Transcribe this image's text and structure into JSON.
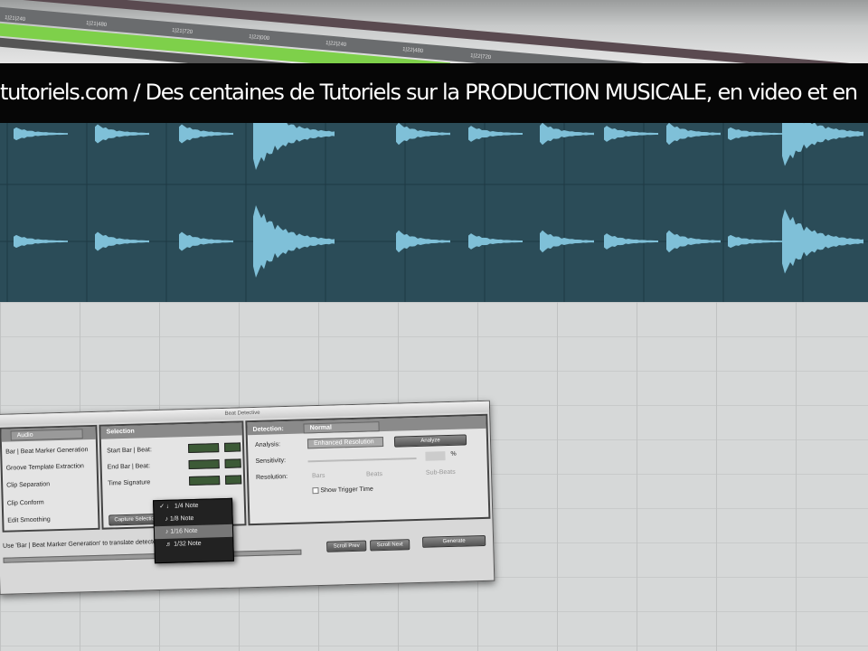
{
  "ruler": {
    "ticks": [
      "1|21|240",
      "1|21|480",
      "1|21|720",
      "1|22|000",
      "1|22|240",
      "1|22|480",
      "1|22|720"
    ]
  },
  "banner": {
    "text": "tutoriels.com / Des centaines de Tutoriels sur la PRODUCTION MUSICALE, en video et en"
  },
  "colors": {
    "waveform_bg": "#2b4c58",
    "waveform": "#7fc0d8",
    "ruler_green": "#7ed04a"
  },
  "dialog": {
    "title": "Beat Detective",
    "mode": "Audio",
    "operations": [
      "Bar | Beat Marker Generation",
      "Groove Template Extraction",
      "Clip Separation",
      "Clip Conform",
      "Edit Smoothing"
    ],
    "selection": {
      "header": "Selection",
      "start": "Start Bar | Beat:",
      "end": "End Bar | Beat:",
      "time_sig": "Time Signature",
      "capture": "Capture Selection"
    },
    "detection": {
      "header": "Detection:",
      "mode": "Normal",
      "analysis_label": "Analysis:",
      "analysis": "Enhanced Resolution",
      "analyze": "Analyze",
      "sensitivity_label": "Sensitivity:",
      "percent": "%",
      "resolution_label": "Resolution:",
      "resolutions": [
        "Bars",
        "Beats",
        "Sub-Beats"
      ],
      "show_trigger": "Show Trigger Time"
    },
    "status": "Use 'Bar | Beat Marker Generation' to translate detected beats to tempo ruler.",
    "buttons": {
      "prev": "Scroll Prev",
      "next": "Scroll Next",
      "generate": "Generate"
    }
  },
  "popup": {
    "items": [
      "1/4 Note",
      "1/8 Note",
      "1/16 Note",
      "1/32 Note"
    ],
    "checked": "✓",
    "highlighted": 2
  }
}
